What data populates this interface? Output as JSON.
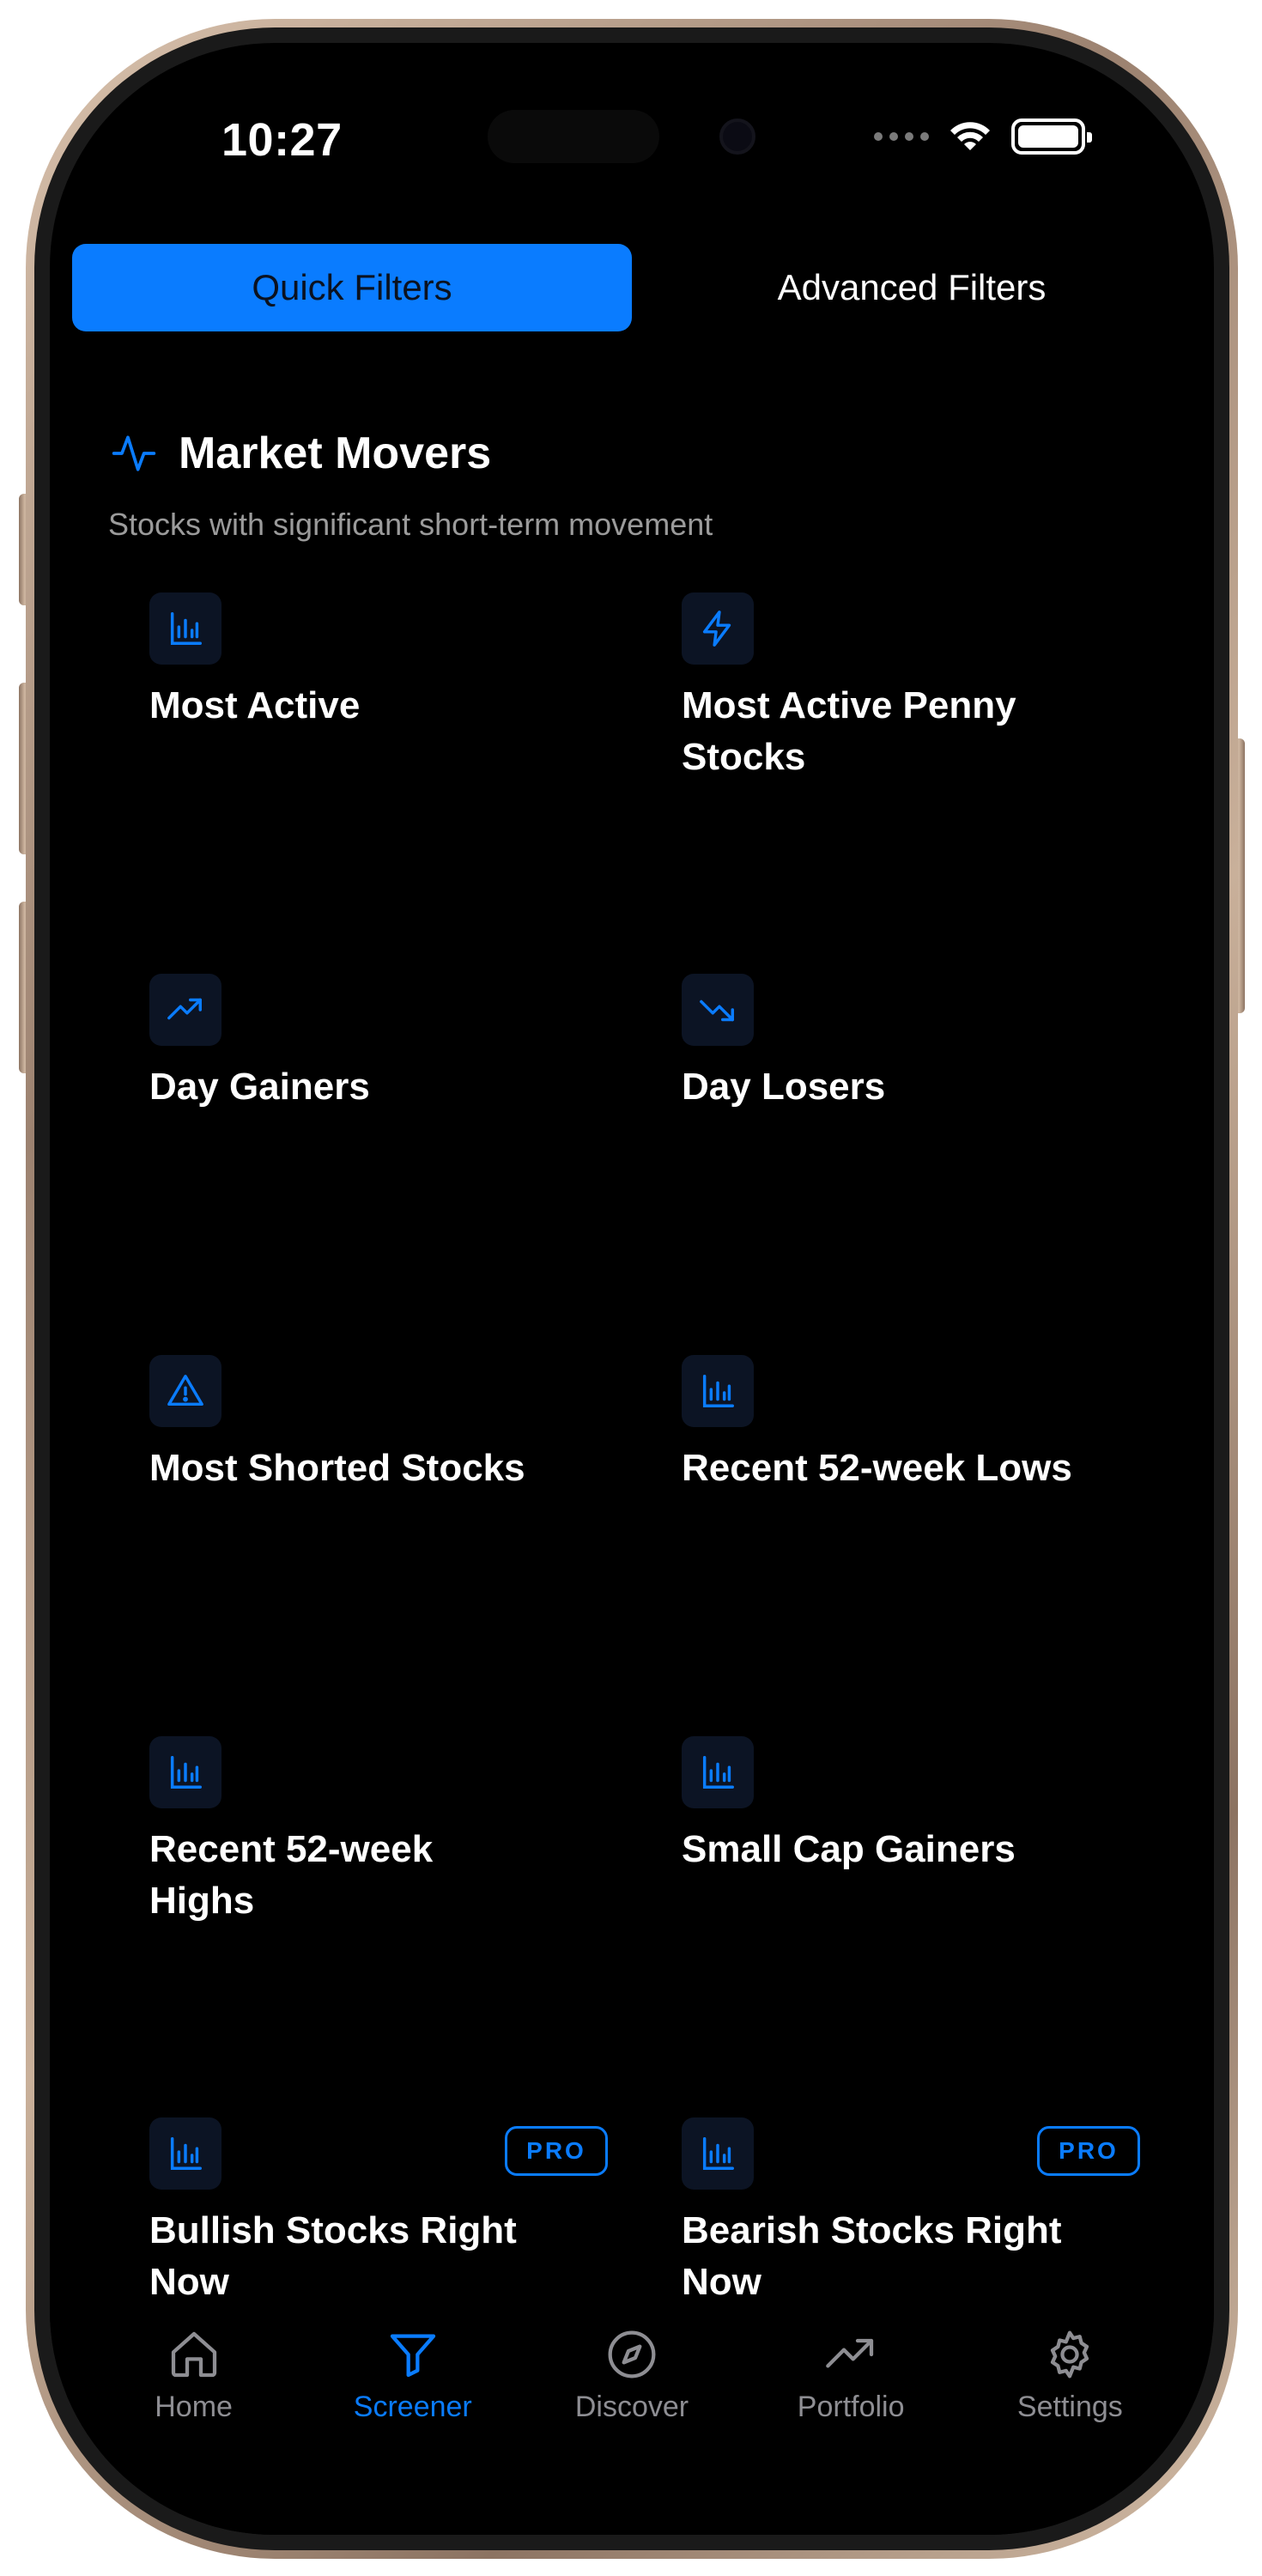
{
  "status_bar": {
    "time": "10:27"
  },
  "segmented": {
    "quick_label": "Quick Filters",
    "advanced_label": "Advanced Filters"
  },
  "section": {
    "icon": "activity-icon",
    "title": "Market Movers",
    "subtitle": "Stocks with significant short-term movement"
  },
  "cards": [
    {
      "label": "Most Active",
      "icon": "bar-chart-icon",
      "pro": false
    },
    {
      "label": "Most Active Penny Stocks",
      "icon": "lightning-icon",
      "pro": false
    },
    {
      "label": "Day Gainers",
      "icon": "trend-up-icon",
      "pro": false
    },
    {
      "label": "Day Losers",
      "icon": "trend-down-icon",
      "pro": false
    },
    {
      "label": "Most Shorted Stocks",
      "icon": "warning-icon",
      "pro": false
    },
    {
      "label": "Recent 52-week Lows",
      "icon": "bar-chart-icon",
      "pro": false
    },
    {
      "label": "Recent 52-week Highs",
      "icon": "bar-chart-icon",
      "pro": false
    },
    {
      "label": "Small Cap Gainers",
      "icon": "bar-chart-icon",
      "pro": false
    },
    {
      "label": "Bullish Stocks Right Now",
      "icon": "bar-chart-icon",
      "pro": true
    },
    {
      "label": "Bearish Stocks Right Now",
      "icon": "bar-chart-icon",
      "pro": true
    }
  ],
  "pro_badge": "PRO",
  "tabbar": {
    "items": [
      {
        "label": "Home",
        "icon": "home-icon"
      },
      {
        "label": "Screener",
        "icon": "funnel-icon"
      },
      {
        "label": "Discover",
        "icon": "compass-icon"
      },
      {
        "label": "Portfolio",
        "icon": "trend-up-icon"
      },
      {
        "label": "Settings",
        "icon": "gear-icon"
      }
    ],
    "active": "Screener"
  },
  "colors": {
    "accent": "#0a7cff",
    "background": "#000000",
    "muted": "#8e8e93"
  }
}
